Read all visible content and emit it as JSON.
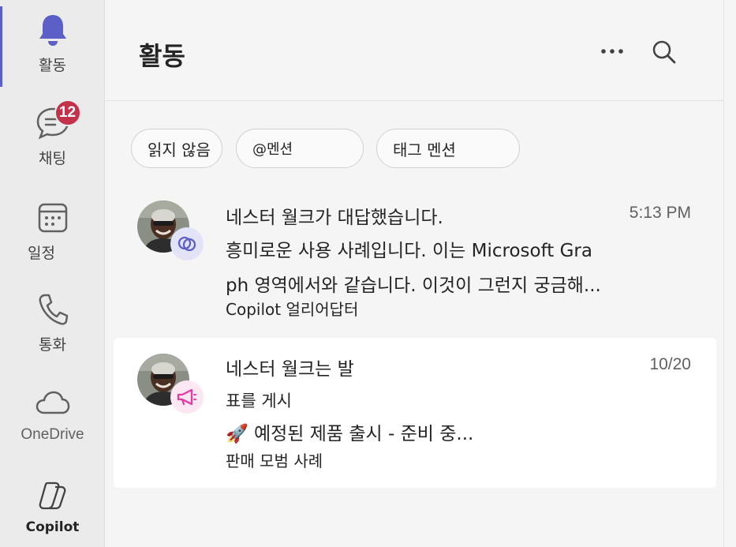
{
  "rail": {
    "items": [
      {
        "label": "활동",
        "icon": "bell-icon",
        "active": true
      },
      {
        "label": "채팅",
        "icon": "chat-icon",
        "badge": "12"
      },
      {
        "label": "일정",
        "icon": "calendar-icon"
      },
      {
        "label": "통화",
        "icon": "phone-icon"
      },
      {
        "label": "OneDrive",
        "icon": "cloud-icon"
      },
      {
        "label": "Copilot",
        "icon": "copilot-icon"
      }
    ]
  },
  "header": {
    "title": "활동"
  },
  "filters": [
    {
      "label": "읽지 않음"
    },
    {
      "label": "@멘션"
    },
    {
      "label": "태그 멘션"
    }
  ],
  "activities": [
    {
      "title": "네스터 월크가 대답했습니다.",
      "time": "5:13 PM",
      "body_line1": "흥미로운 사용 사례입니다. 이는 Microsoft Gra",
      "body_line2": "ph 영역에서와 같습니다. 이것이 그런지 궁금해...",
      "source": "Copilot 얼리어답터",
      "badge_icon": "reply-icon",
      "selected": false
    },
    {
      "title": "네스터 월크는 발",
      "time": "10/20",
      "body_line1": "표를 게시",
      "body_line2": "🚀 예정된 제품 출시 - 준비 중...",
      "source": "판매 모범 사례",
      "badge_icon": "megaphone-icon",
      "selected": true
    }
  ],
  "colors": {
    "accent": "#5b5fc7",
    "badge": "#c4314b",
    "rail_bg": "#ebebeb",
    "main_bg": "#f5f5f5",
    "megaphone": "#e43ba6"
  }
}
